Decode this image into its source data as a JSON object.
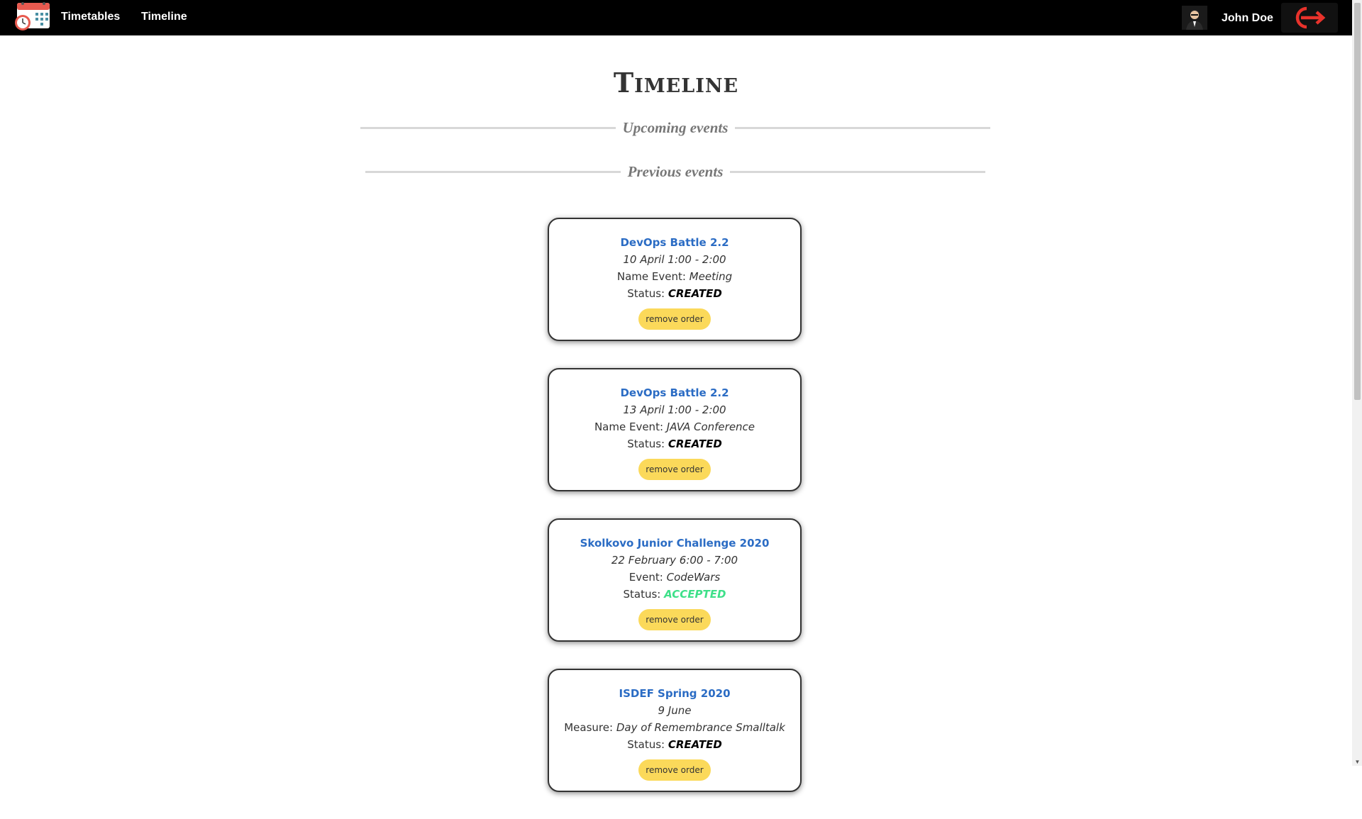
{
  "navbar": {
    "logo_icon": "calendar-clock-icon",
    "links": [
      "Timetables",
      "Timeline"
    ],
    "user_name": "John Doe",
    "avatar_icon": "user-avatar-icon",
    "logout_icon": "logout-arrow-icon"
  },
  "page": {
    "title": "Timeline",
    "upcoming_label": "Upcoming events",
    "previous_label": "Previous events"
  },
  "cards": [
    {
      "title": "DevOps Battle 2.2",
      "date": "10 April 1:00 - 2:00",
      "event_label": "Name Event:",
      "event_value": "Meeting",
      "status_label": "Status:",
      "status_value": "CREATED",
      "button": "remove order"
    },
    {
      "title": "DevOps Battle 2.2",
      "date": "13 April 1:00 - 2:00",
      "event_label": "Name Event:",
      "event_value": "JAVA Conference",
      "status_label": "Status:",
      "status_value": "CREATED",
      "button": "remove order"
    },
    {
      "title": "Skolkovo Junior Challenge 2020",
      "date": "22 February 6:00 - 7:00",
      "event_label": "Event:",
      "event_value": "CodeWars",
      "status_label": "Status:",
      "status_value": "ACCEPTED",
      "button": "remove order"
    },
    {
      "title": "ISDEF Spring 2020",
      "date": "9 June",
      "event_label": "Measure:",
      "event_value": "Day of Remembrance Smalltalk",
      "status_label": "Status:",
      "status_value": "CREATED",
      "button": "remove order"
    }
  ],
  "colors": {
    "navbar": "#000000",
    "link": "#2b6cc4",
    "button": "#fbd95a",
    "accepted": "#3ee089",
    "logout_arrow": "#e8322b"
  }
}
